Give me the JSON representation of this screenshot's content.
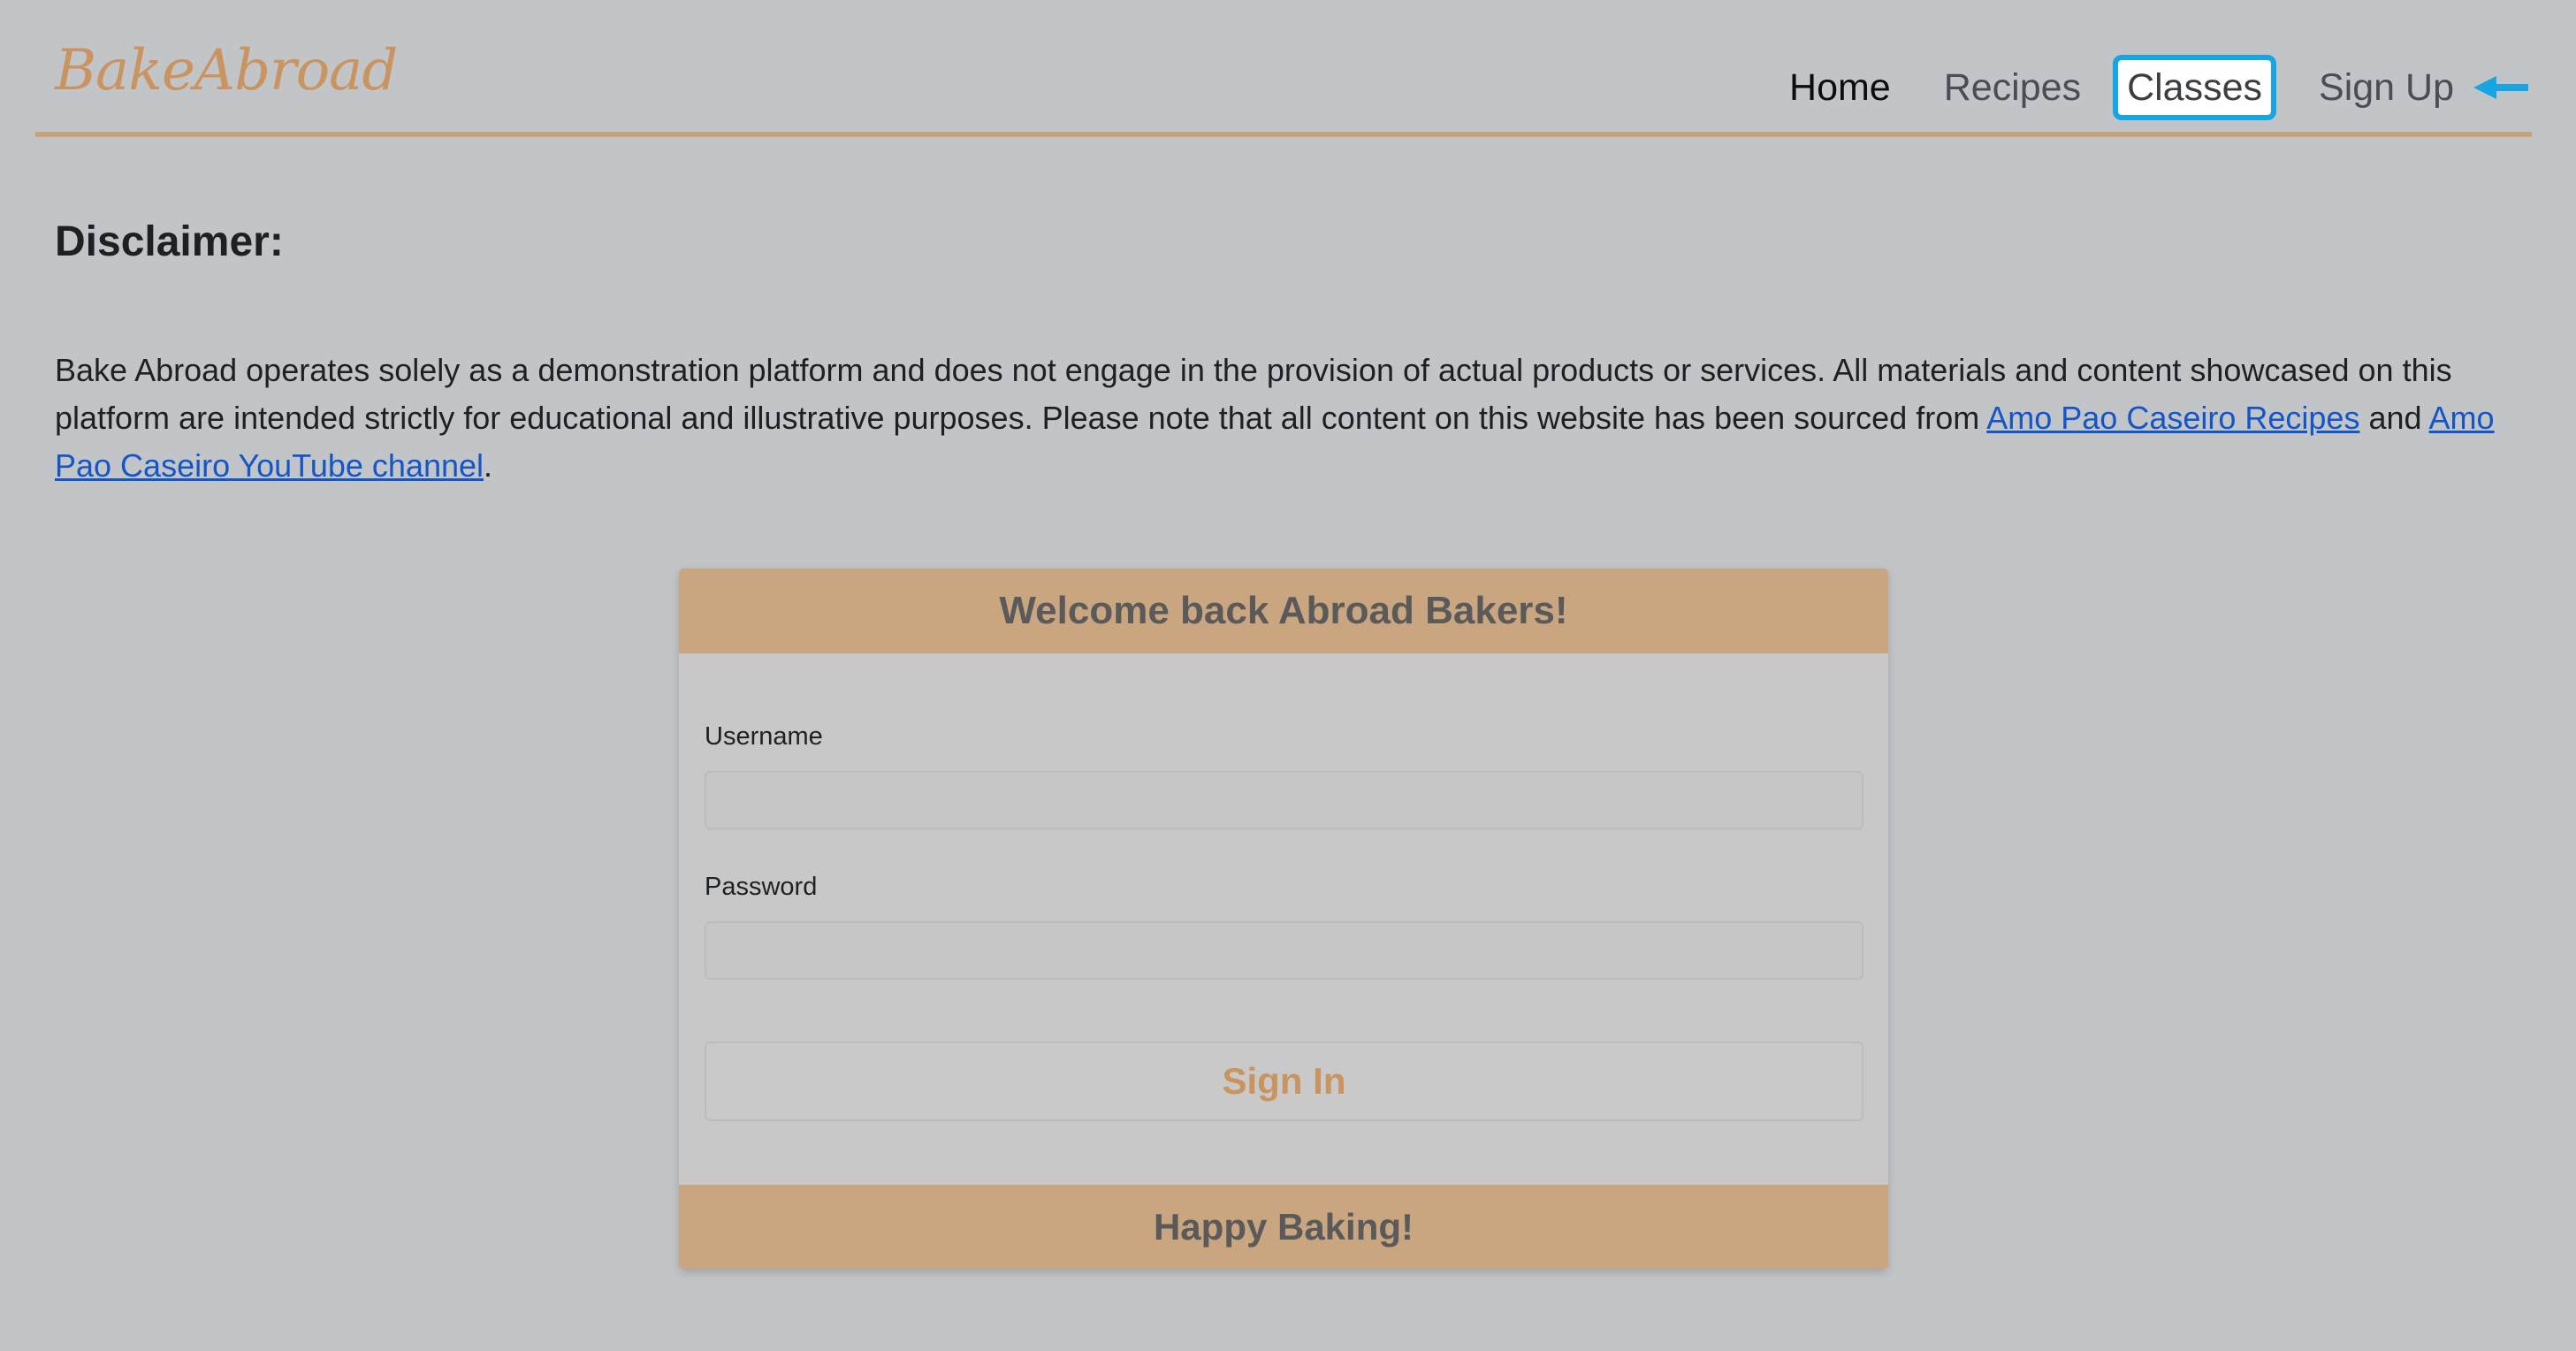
{
  "navbar": {
    "brand": "BakeAbroad",
    "links": [
      {
        "label": "Home",
        "state": "active"
      },
      {
        "label": "Recipes",
        "state": "default"
      },
      {
        "label": "Classes",
        "state": "focused"
      },
      {
        "label": "Sign Up",
        "state": "default"
      }
    ],
    "pointer_icon": "arrow-left-icon",
    "colors": {
      "brand": "#c9945f",
      "underline": "#c9a27a",
      "focus_ring": "#16a6e4"
    }
  },
  "disclaimer": {
    "title": "Disclaimer:",
    "text_before": "Bake Abroad operates solely as a demonstration platform and does not engage in the provision of actual products or services. All materials and content showcased on this platform are intended strictly for educational and illustrative purposes. Please note that all content on this website has been sourced from ",
    "link1": "Amo Pao Caseiro Recipes",
    "text_middle": " and ",
    "link2": "Amo Pao Caseiro YouTube channel",
    "text_after": "."
  },
  "login_card": {
    "header": "Welcome back Abroad Bakers!",
    "username_label": "Username",
    "username_value": "",
    "password_label": "Password",
    "password_value": "",
    "submit_label": "Sign In",
    "footer": "Happy Baking!",
    "colors": {
      "header_bg": "#c9a580",
      "submit_text": "#c9945f"
    }
  }
}
